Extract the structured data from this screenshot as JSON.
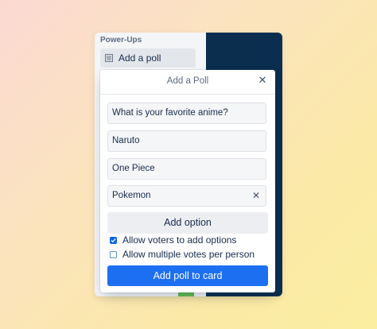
{
  "sidebar": {
    "section_label": "Power-Ups",
    "item_label": "Add a poll",
    "item_icon": "list-icon"
  },
  "dialog": {
    "title": "Add a Poll",
    "close_icon": "close-icon",
    "question_value": "What is your favorite anime?",
    "options": [
      "Naruto",
      "One Piece",
      "Pokemon"
    ],
    "add_option_label": "Add option",
    "checkboxes": [
      {
        "label": "Allow voters to add options",
        "checked": true
      },
      {
        "label": "Allow multiple votes per person",
        "checked": false
      }
    ],
    "submit_label": "Add poll to card"
  },
  "colors": {
    "accent": "#1d6ff2",
    "dark_panel": "#0b2e4f"
  }
}
